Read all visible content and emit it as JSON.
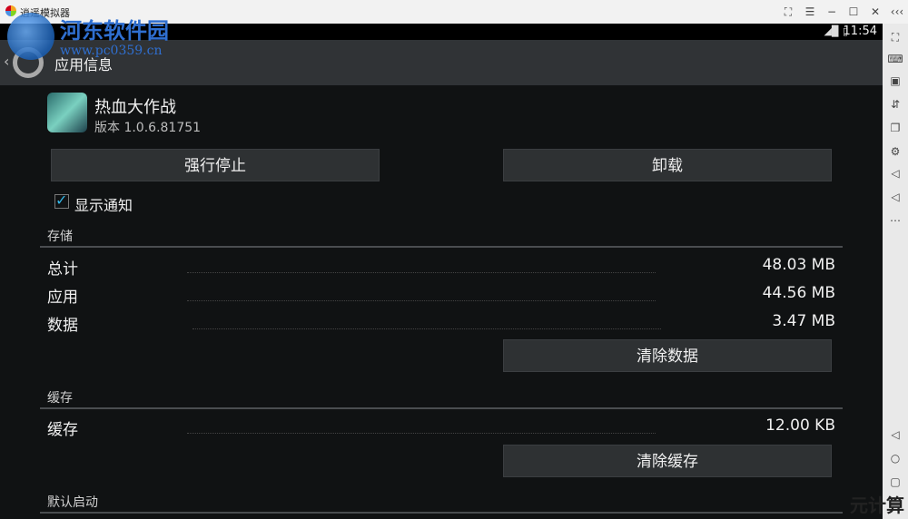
{
  "window": {
    "title": "逍遥模拟器"
  },
  "watermark": {
    "line1": "河东软件园",
    "line2": "www.pc0359.cn"
  },
  "status": {
    "time": "11:54"
  },
  "actionbar": {
    "title": "应用信息"
  },
  "app": {
    "name": "热血大作战",
    "version": "版本 1.0.6.81751"
  },
  "buttons": {
    "force_stop": "强行停止",
    "uninstall": "卸载",
    "clear_data": "清除数据",
    "clear_cache": "清除缓存"
  },
  "notifications": {
    "label": "显示通知",
    "checked": true
  },
  "storage": {
    "section": "存储",
    "rows": [
      {
        "label": "总计",
        "value": "48.03 MB"
      },
      {
        "label": "应用",
        "value": "44.56 MB"
      },
      {
        "label": "数据",
        "value": "3.47 MB"
      }
    ]
  },
  "cache": {
    "section": "缓存",
    "label": "缓存",
    "value": "12.00 KB"
  },
  "default_launch": {
    "section": "默认启动"
  },
  "corner_watermark": "元计算"
}
